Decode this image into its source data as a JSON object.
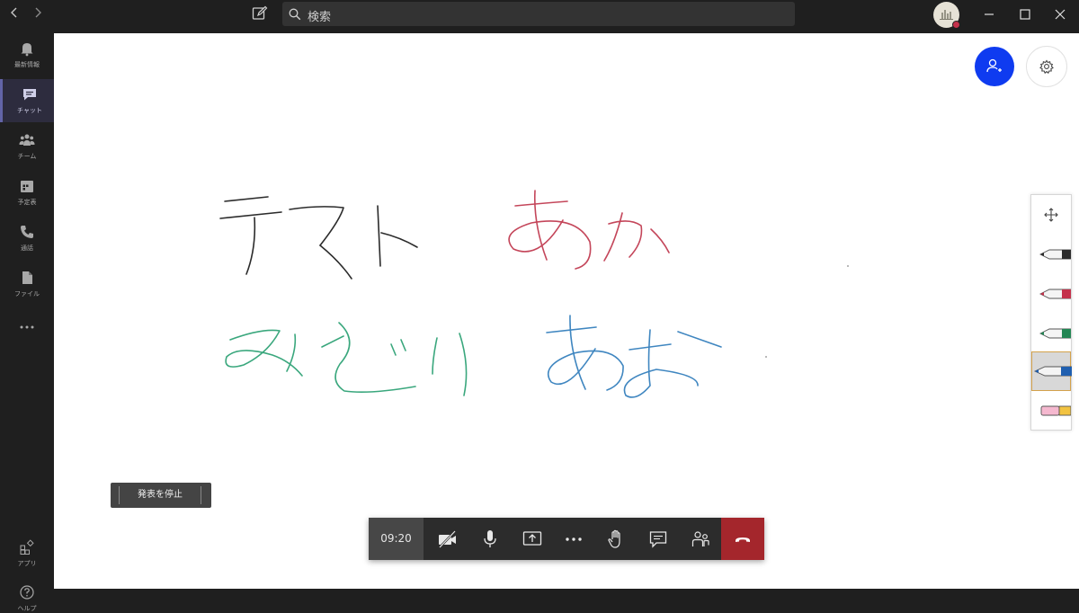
{
  "titlebar": {
    "search_placeholder": "検索",
    "icons": [
      "back-arrow-icon",
      "forward-arrow-icon",
      "compose-icon",
      "search-icon",
      "minimize-icon",
      "maximize-icon",
      "close-icon"
    ]
  },
  "rail": {
    "items": [
      {
        "label": "最新情報",
        "icon": "bell-icon"
      },
      {
        "label": "チャット",
        "icon": "chat-icon",
        "active": true
      },
      {
        "label": "チーム",
        "icon": "teams-icon"
      },
      {
        "label": "予定表",
        "icon": "calendar-icon"
      },
      {
        "label": "通話",
        "icon": "phone-icon"
      },
      {
        "label": "ファイル",
        "icon": "file-icon"
      },
      {
        "label": "",
        "icon": "more-icon"
      },
      {
        "label": "アプリ",
        "icon": "apps-icon"
      },
      {
        "label": "ヘルプ",
        "icon": "help-icon"
      }
    ]
  },
  "whiteboard": {
    "ink_colors": {
      "black": "#2b2b2b",
      "red": "#c4465a",
      "green": "#3aa77d",
      "blue": "#3f86c0"
    },
    "tools": [
      "pan-icon",
      "black-pen-icon",
      "red-pen-icon",
      "green-pen-icon",
      "blue-pen-icon",
      "highlighter-icon"
    ],
    "selected_tool": "blue-pen-icon"
  },
  "presentation": {
    "stop_label": "発表を停止"
  },
  "callbar": {
    "timer": "09:20",
    "buttons": [
      "camera-off-icon",
      "mic-icon",
      "share-icon",
      "more-icon",
      "raise-hand-icon",
      "chat-icon",
      "participants-icon",
      "hang-up-icon"
    ],
    "hangup_color": "#a4262c"
  },
  "colors": {
    "accent": "#6264a7",
    "invite": "#0f3bf0"
  }
}
